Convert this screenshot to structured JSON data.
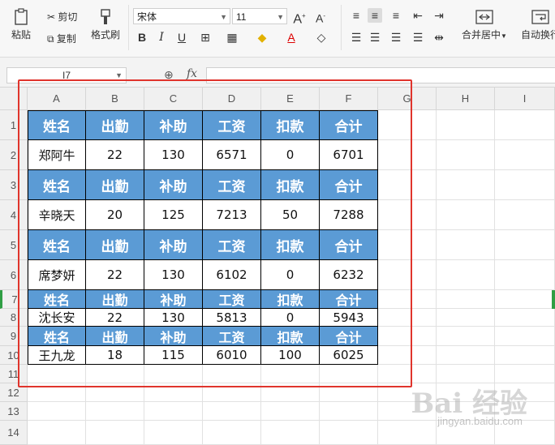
{
  "ribbon": {
    "paste": "粘贴",
    "cut": "剪切",
    "copy": "复制",
    "format_painter": "格式刷",
    "font_name": "宋体",
    "font_size": "11",
    "merge_center": "合并居中",
    "auto_wrap": "自动换行"
  },
  "formula": {
    "name_box": "I7",
    "fx_label": "fx"
  },
  "columns": [
    "A",
    "B",
    "C",
    "D",
    "E",
    "F",
    "G",
    "H",
    "I"
  ],
  "rows": [
    "1",
    "2",
    "3",
    "4",
    "5",
    "6",
    "7",
    "8",
    "9",
    "10",
    "11",
    "12",
    "13",
    "14"
  ],
  "table": {
    "headers": [
      "姓名",
      "出勤",
      "补助",
      "工资",
      "扣款",
      "合计"
    ],
    "records": [
      [
        "郑阿牛",
        "22",
        "130",
        "6571",
        "0",
        "6701"
      ],
      [
        "辛晓天",
        "20",
        "125",
        "7213",
        "50",
        "7288"
      ],
      [
        "席梦妍",
        "22",
        "130",
        "6102",
        "0",
        "6232"
      ],
      [
        "沈长安",
        "22",
        "130",
        "5813",
        "0",
        "5943"
      ],
      [
        "王九龙",
        "18",
        "115",
        "6010",
        "100",
        "6025"
      ]
    ]
  },
  "colors": {
    "header_fill": "#5b9bd5",
    "highlight_box": "#e0342c"
  },
  "watermark": {
    "brand": "Bai 经验",
    "url": "jingyan.baidu.com"
  }
}
